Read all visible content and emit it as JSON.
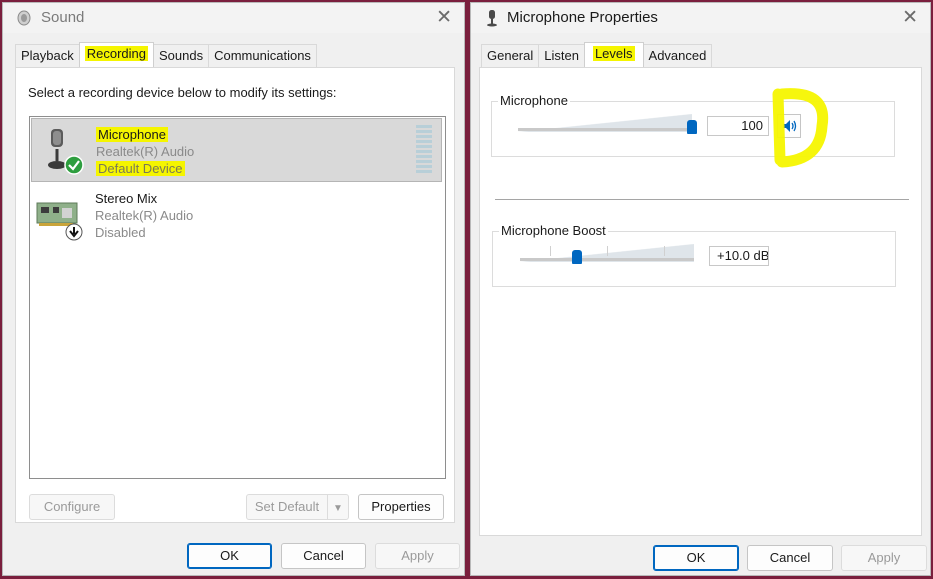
{
  "sound": {
    "title": "Sound",
    "close": "✕",
    "tabs": [
      "Playback",
      "Recording",
      "Sounds",
      "Communications"
    ],
    "instruction": "Select a recording device below to modify its settings:",
    "devices": [
      {
        "name": "Microphone",
        "driver": "Realtek(R) Audio",
        "status": "Default Device"
      },
      {
        "name": "Stereo Mix",
        "driver": "Realtek(R) Audio",
        "status": "Disabled"
      }
    ],
    "buttons": {
      "configure": "Configure",
      "set_default": "Set Default",
      "properties": "Properties",
      "ok": "OK",
      "cancel": "Cancel",
      "apply": "Apply"
    }
  },
  "props": {
    "title": "Microphone Properties",
    "close": "✕",
    "tabs": [
      "General",
      "Listen",
      "Levels",
      "Advanced"
    ],
    "mic": {
      "label": "Microphone",
      "value": "100",
      "level": 1.0
    },
    "boost": {
      "label": "Microphone Boost",
      "value": "+10.0 dB",
      "level": 0.33
    },
    "buttons": {
      "ok": "OK",
      "cancel": "Cancel",
      "apply": "Apply"
    }
  },
  "colors": {
    "highlight": "#f5f500",
    "accent": "#0067c0",
    "frame": "#7a1f3d"
  }
}
